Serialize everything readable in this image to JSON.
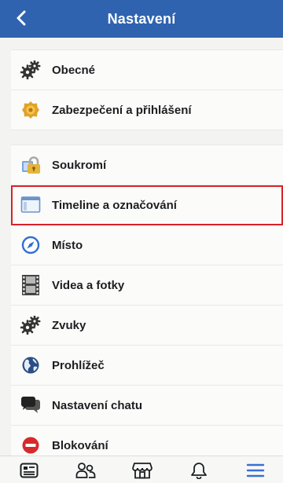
{
  "header": {
    "title": "Nastavení",
    "back_icon": "chevron-left-icon"
  },
  "settings": {
    "items": [
      {
        "label": "Obecné",
        "icon": "gears-icon"
      },
      {
        "label": "Zabezpečení a přihlášení",
        "icon": "shield-badge-icon"
      },
      {
        "label": "Soukromí",
        "icon": "padlock-icon"
      },
      {
        "label": "Timeline a označování",
        "icon": "timeline-window-icon"
      },
      {
        "label": "Místo",
        "icon": "compass-icon"
      },
      {
        "label": "Videa a fotky",
        "icon": "film-strip-icon"
      },
      {
        "label": "Zvuky",
        "icon": "gears-icon"
      },
      {
        "label": "Prohlížeč",
        "icon": "globe-icon"
      },
      {
        "label": "Nastavení chatu",
        "icon": "chat-bubbles-icon"
      },
      {
        "label": "Blokování",
        "icon": "block-icon"
      }
    ],
    "selected_index": 3
  },
  "tabbar": {
    "tabs": [
      "news-feed-icon",
      "friends-icon",
      "marketplace-icon",
      "notifications-icon",
      "menu-icon"
    ],
    "active_index": 4
  },
  "colors": {
    "header": "#2f63b0",
    "selected_outline": "#d8232a",
    "active_tab": "#3b6fd0"
  }
}
